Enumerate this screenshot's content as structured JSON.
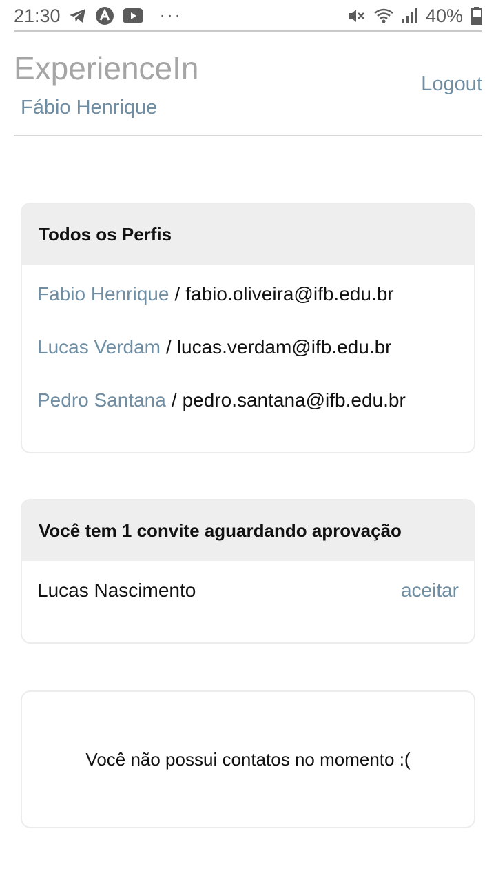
{
  "status_bar": {
    "time": "21:30",
    "left_icons": [
      "telegram-icon",
      "app-a-icon",
      "youtube-icon"
    ],
    "more": "···",
    "right_icons": [
      "mute-icon",
      "wifi-icon",
      "signal-icon"
    ],
    "battery": "40%"
  },
  "header": {
    "brand": "ExperienceIn",
    "user": "Fábio Henrique",
    "logout": "Logout"
  },
  "profiles": {
    "title": "Todos os Perfis",
    "separator": "/",
    "items": [
      {
        "name": "Fabio Henrique",
        "email": "fabio.oliveira@ifb.edu.br"
      },
      {
        "name": "Lucas Verdam",
        "email": "lucas.verdam@ifb.edu.br"
      },
      {
        "name": "Pedro Santana",
        "email": "pedro.santana@ifb.edu.br"
      }
    ]
  },
  "invites": {
    "title": "Você tem 1 convite aguardando aprovação",
    "items": [
      {
        "name": "Lucas Nascimento",
        "action": "aceitar"
      }
    ]
  },
  "contacts": {
    "empty_message": "Você não possui contatos no momento :("
  },
  "colors": {
    "link": "#6f8ea3",
    "brand": "#a5a5a5",
    "card_header_bg": "#eeeeee"
  }
}
